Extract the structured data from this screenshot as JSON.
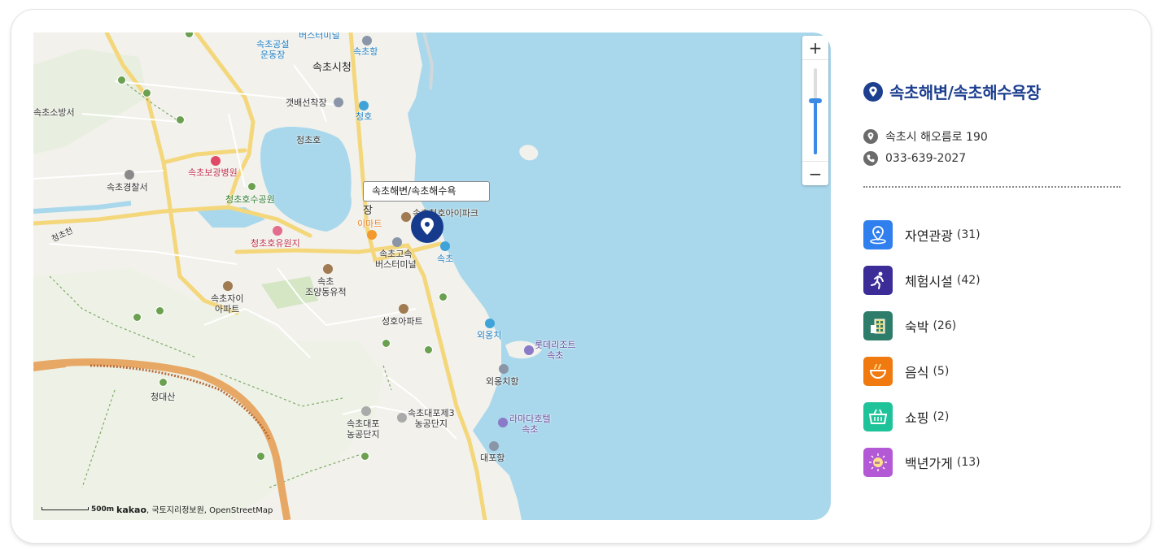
{
  "place": {
    "title": "속초해변/속초해수욕장",
    "address": "속초시 해오름로 190",
    "phone": "033-639-2027"
  },
  "categories": [
    {
      "name": "자연관광",
      "count": "(31)",
      "color": "#2f7fee",
      "icon": "mountain-pin-icon"
    },
    {
      "name": "체험시설",
      "count": "(42)",
      "color": "#3b2c98",
      "icon": "running-person-icon"
    },
    {
      "name": "숙박",
      "count": "(26)",
      "color": "#2e7d6a",
      "icon": "building-icon"
    },
    {
      "name": "음식",
      "count": "(5)",
      "color": "#f07a10",
      "icon": "bowl-icon"
    },
    {
      "name": "쇼핑",
      "count": "(2)",
      "color": "#1fc39a",
      "icon": "basket-icon"
    },
    {
      "name": "백년가게",
      "count": "(13)",
      "color": "#b459d6",
      "icon": "hundred-badge-icon"
    }
  ],
  "map": {
    "tooltip": "속초해변/속초해수욕",
    "zoom_in": "+",
    "zoom_out": "−",
    "scale_distance": "500m",
    "attribution_brand": "kakao",
    "attribution_rest": ", 국토지리정보원, OpenStreetMap",
    "labels": {
      "bus_terminal_top": "버스터미널",
      "sports_field": "속초공설\n운동장",
      "city_hall": "속초시청",
      "port": "속초항",
      "ferry": "갯배선착장",
      "cheongho": "청호",
      "fire_station": "속초소방서",
      "cheongcho_lake": "청초호",
      "hospital": "속초보광병원",
      "police": "속초경찰서",
      "lake_park": "청초호수공원",
      "jang": "장",
      "emart": "이마트",
      "apartment_park": "속초청호아이파크",
      "amusement": "청초호유원지",
      "cheongcho_stream": "청초천",
      "express_bus": "속초고속\n버스터미널",
      "sokcho_beach": "속초",
      "historic_site": "속초\n조양동유적",
      "jai_apt": "속초자이\n아파트",
      "seongho_apt": "성호아파트",
      "oeongchi": "외옹치",
      "lotte_resort": "롯데리조트\n속초",
      "oeongchi_port": "외옹치항",
      "cheongdaesan": "청대산",
      "daepo_complex": "속초대포\n농공단지",
      "daepo_complex3": "속초대포제3\n농공단지",
      "ramada": "라마다호텔\n속초",
      "daepo_port": "대포항"
    }
  }
}
